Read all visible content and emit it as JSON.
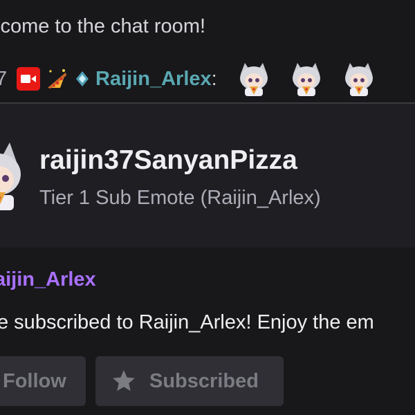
{
  "chat": {
    "welcome_text": "lcome to the chat room!",
    "message": {
      "timestamp_fragment": "7",
      "badges": [
        {
          "icon": "video-camera-icon",
          "color": "#e91916"
        },
        {
          "icon": "pizza-icon"
        },
        {
          "icon": "diamond-icon"
        }
      ],
      "username": "Raijin_Arlex",
      "username_color": "#5aa8b2",
      "separator": ":",
      "emotes": [
        "sanyan-pizza-emote",
        "sanyan-pizza-emote",
        "sanyan-pizza-emote"
      ]
    }
  },
  "emote_card": {
    "emote_name": "raijin37SanyanPizza",
    "emote_subtitle": "Tier 1 Sub Emote (Raijin_Arlex)",
    "channel_name": "aijin_Arlex",
    "channel_color": "#a970ff",
    "subscription_message": "e subscribed to Raijin_Arlex! Enjoy the em",
    "buttons": {
      "follow_label": "Follow",
      "subscribed_label": "Subscribed"
    }
  },
  "colors": {
    "background": "#18181b",
    "card_background": "#1f1f23",
    "button_background": "#2f2f35"
  }
}
